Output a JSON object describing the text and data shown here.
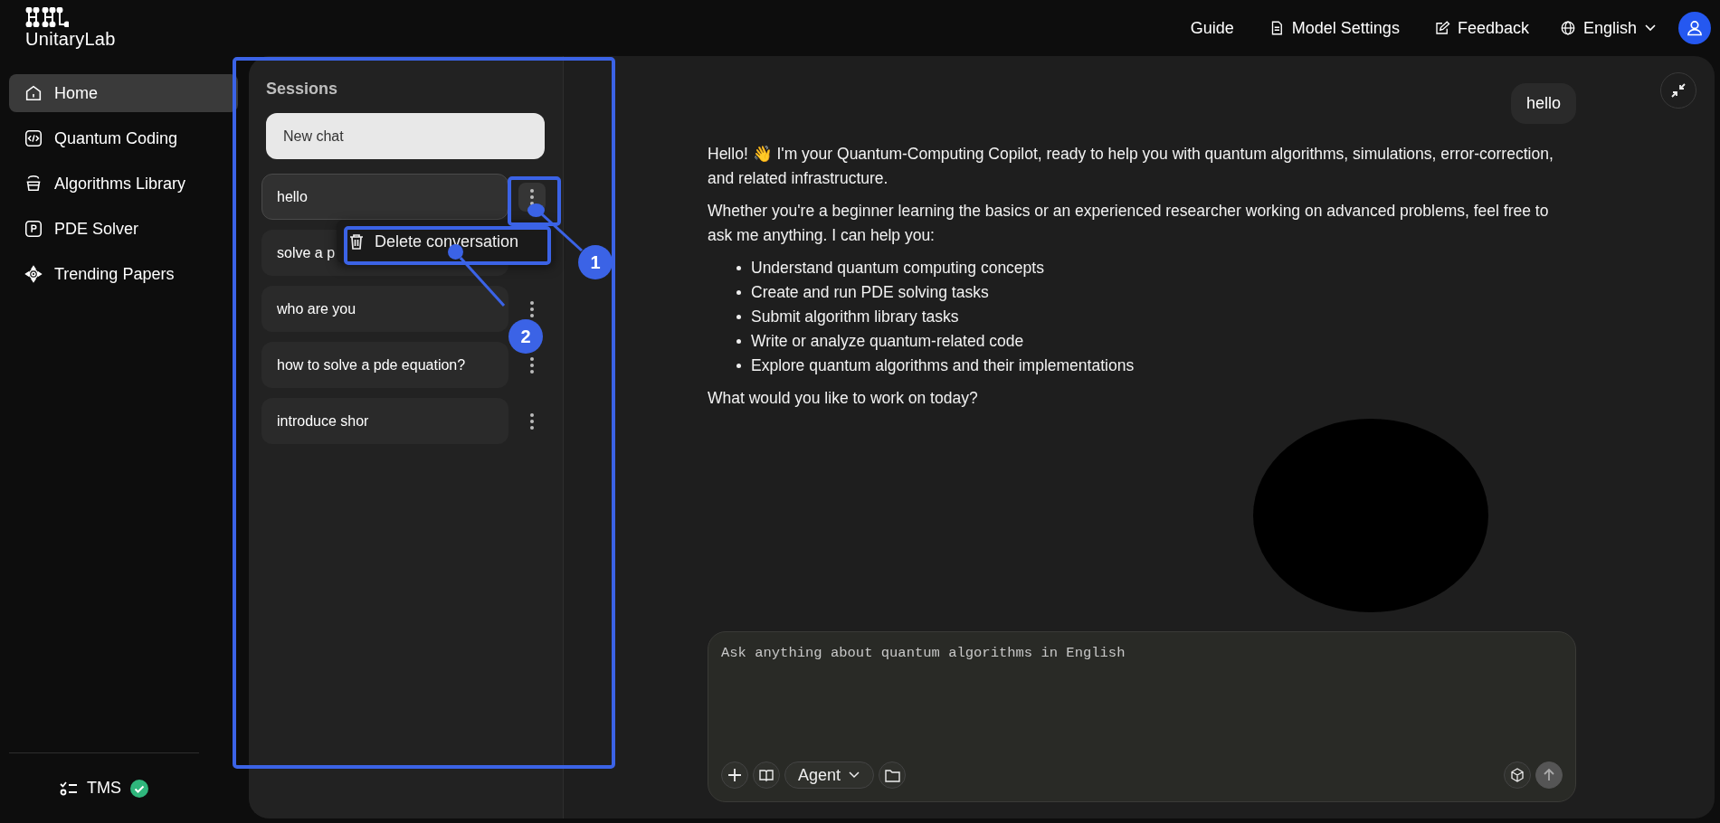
{
  "logo": {
    "text": "UnitaryLab"
  },
  "nav": [
    {
      "label": "Home",
      "selected": true
    },
    {
      "label": "Quantum Coding",
      "selected": false
    },
    {
      "label": "Algorithms Library",
      "selected": false
    },
    {
      "label": "PDE Solver",
      "selected": false
    },
    {
      "label": "Trending Papers",
      "selected": false
    }
  ],
  "tms": {
    "label": "TMS",
    "ok": true
  },
  "header": {
    "links": [
      "Guide",
      "Model Settings",
      "Feedback"
    ],
    "language": "English"
  },
  "sessions": {
    "title": "Sessions",
    "new_chat": "New chat",
    "items": [
      {
        "title": "hello",
        "selected": true
      },
      {
        "title": "solve a p",
        "selected": false
      },
      {
        "title": "who are you",
        "selected": false
      },
      {
        "title": "how to solve a pde equation?",
        "selected": false
      },
      {
        "title": "introduce shor",
        "selected": false
      }
    ]
  },
  "context_menu": {
    "items": [
      {
        "label": "Delete conversation"
      }
    ]
  },
  "chat": {
    "user_message": "hello",
    "intro": "Hello! 👋 I'm your Quantum-Computing Copilot, ready to help you with quantum algorithms, simulations, error-correction, and related infrastructure.",
    "paragraph": "Whether you're a beginner learning the basics or an experienced researcher working on advanced problems, feel free to ask me anything. I can help you:",
    "bullets": [
      "Understand quantum computing concepts",
      "Create and run PDE solving tasks",
      "Submit algorithm library tasks",
      "Write or analyze quantum-related code",
      "Explore quantum algorithms and their implementations"
    ],
    "closing": "What would you like to work on today?"
  },
  "composer": {
    "placeholder": "Ask anything about quantum algorithms in English",
    "mode": "Agent"
  },
  "annotations": [
    {
      "label": "1"
    },
    {
      "label": "2"
    }
  ]
}
